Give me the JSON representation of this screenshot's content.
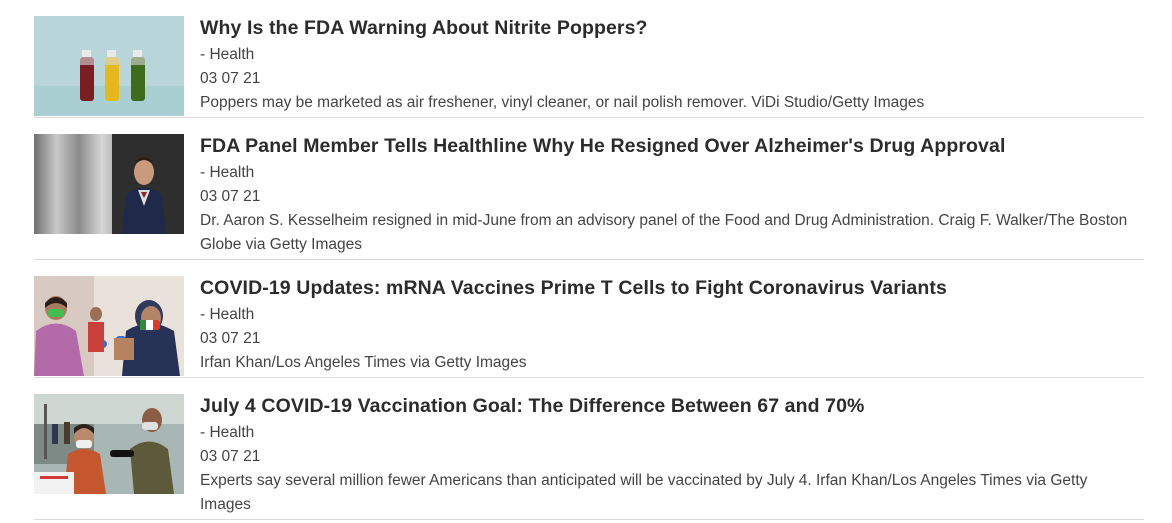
{
  "articles": [
    {
      "thumbnail_icon": "juice-bottles-image",
      "title": "Why Is the FDA Warning About Nitrite Poppers?",
      "category": "- Health",
      "date": "03 07 21",
      "caption": "Poppers may be marketed as air freshener, vinyl cleaner, or nail polish remover. ViDi Studio/Getty Images"
    },
    {
      "thumbnail_icon": "man-in-suit-portrait-image",
      "title": "FDA Panel Member Tells Healthline Why He Resigned Over Alzheimer's Drug Approval",
      "category": "- Health",
      "date": "03 07 21",
      "caption": "Dr. Aaron S. Kesselheim resigned in mid-June from an advisory panel of the Food and Drug Administration. Craig F. Walker/The Boston Globe via Getty Images"
    },
    {
      "thumbnail_icon": "vaccination-child-image",
      "title": "COVID-19 Updates: mRNA Vaccines Prime T Cells to Fight Coronavirus Variants",
      "category": "- Health",
      "date": "03 07 21",
      "caption": "Irfan Khan/Los Angeles Times via Getty Images"
    },
    {
      "thumbnail_icon": "vaccination-site-image",
      "title": "July 4 COVID-19 Vaccination Goal: The Difference Between 67 and 70%",
      "category": "- Health",
      "date": "03 07 21",
      "caption": "Experts say several million fewer Americans than anticipated will be vaccinated by July 4. Irfan Khan/Los Angeles Times via Getty Images"
    }
  ]
}
